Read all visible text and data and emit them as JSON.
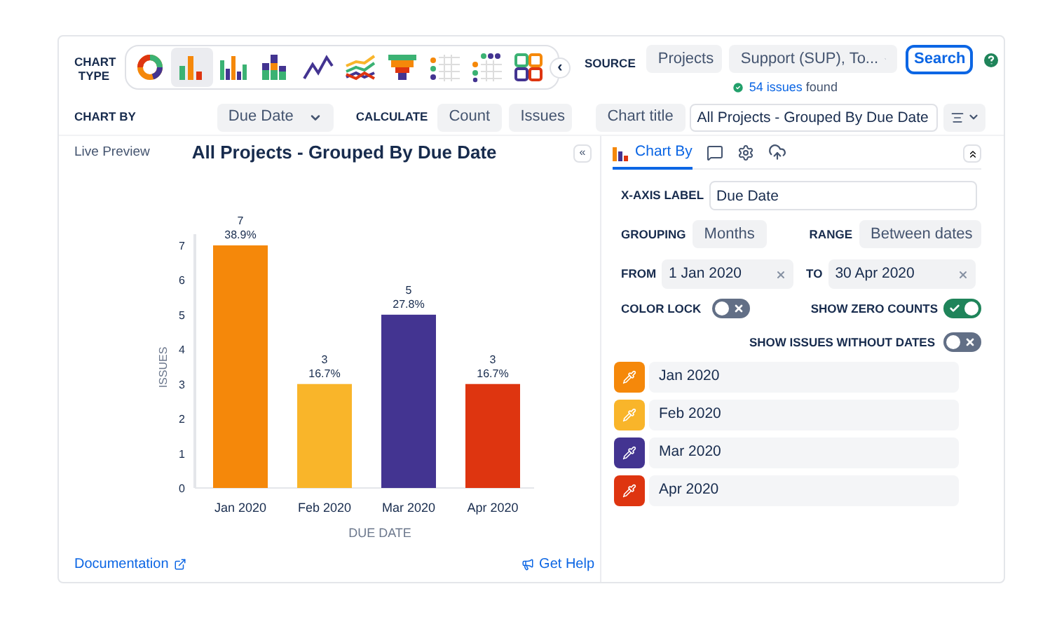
{
  "toolbar": {
    "chart_type_label": "CHART TYPE",
    "chart_types": [
      {
        "kind": "donut",
        "selected": false
      },
      {
        "kind": "bar",
        "selected": true
      },
      {
        "kind": "grouped-bar",
        "selected": false
      },
      {
        "kind": "stacked-bar",
        "selected": false
      },
      {
        "kind": "line",
        "selected": false
      },
      {
        "kind": "multi-line",
        "selected": false
      },
      {
        "kind": "funnel",
        "selected": false
      },
      {
        "kind": "dot-grid",
        "selected": false
      },
      {
        "kind": "dot-matrix",
        "selected": false
      },
      {
        "kind": "tiles",
        "selected": false
      }
    ],
    "collapse_button": "‹",
    "source_label": "SOURCE",
    "source_type": "Projects",
    "source_value": "Support (SUP), To...",
    "search_button": "Search",
    "issues_found_link": "54 issues",
    "issues_found_text": "found"
  },
  "options": {
    "chart_by_label": "CHART BY",
    "chart_by_value": "Due Date",
    "calculate_label": "CALCULATE",
    "calculate_value": "Count",
    "calculate_of": "Issues",
    "title_mode": "Chart title",
    "title_value": "All Projects - Grouped By Due Date"
  },
  "preview": {
    "tab": "Live Preview",
    "collapse_button": "«",
    "chart_data": {
      "type": "bar",
      "title": "All Projects - Grouped By Due Date",
      "xlabel": "DUE DATE",
      "ylabel": "ISSUES",
      "categories": [
        "Jan 2020",
        "Feb 2020",
        "Mar 2020",
        "Apr 2020"
      ],
      "series": [
        {
          "values": [
            7,
            3,
            5,
            3
          ]
        }
      ],
      "yticks": [
        0,
        1,
        2,
        3,
        4,
        5,
        6,
        7
      ],
      "ylim": [
        0,
        7
      ],
      "value_labels": [
        [
          "7",
          "38.9%"
        ],
        [
          "3",
          "16.7%"
        ],
        [
          "5",
          "27.8%"
        ],
        [
          "3",
          "16.7%"
        ]
      ]
    },
    "documentation_link": "Documentation",
    "help_link": "Get Help"
  },
  "settings": {
    "tabs": [
      {
        "kind": "chart-by",
        "label": "Chart By",
        "selected": true
      },
      {
        "kind": "comment",
        "selected": false
      },
      {
        "kind": "gear",
        "selected": false
      },
      {
        "kind": "cloud",
        "selected": false
      }
    ],
    "x_axis_label": "X-AXIS LABEL",
    "x_axis_value": "Due Date",
    "grouping_label": "GROUPING",
    "grouping_value": "Months",
    "range_label": "RANGE",
    "range_value": "Between dates",
    "from_label": "FROM",
    "from_value": "1 Jan 2020",
    "to_label": "TO",
    "to_value": "30 Apr 2020",
    "toggles": [
      {
        "label": "COLOR LOCK",
        "on": false
      },
      {
        "label": "SHOW ZERO COUNTS",
        "on": true
      },
      {
        "label": "SHOW ISSUES WITHOUT DATES",
        "on": false
      }
    ],
    "series_colors": [
      {
        "label": "Jan 2020",
        "color": "#f5880a"
      },
      {
        "label": "Feb 2020",
        "color": "#f9b52a"
      },
      {
        "label": "Mar 2020",
        "color": "#433491"
      },
      {
        "label": "Apr 2020",
        "color": "#de3510"
      }
    ]
  }
}
